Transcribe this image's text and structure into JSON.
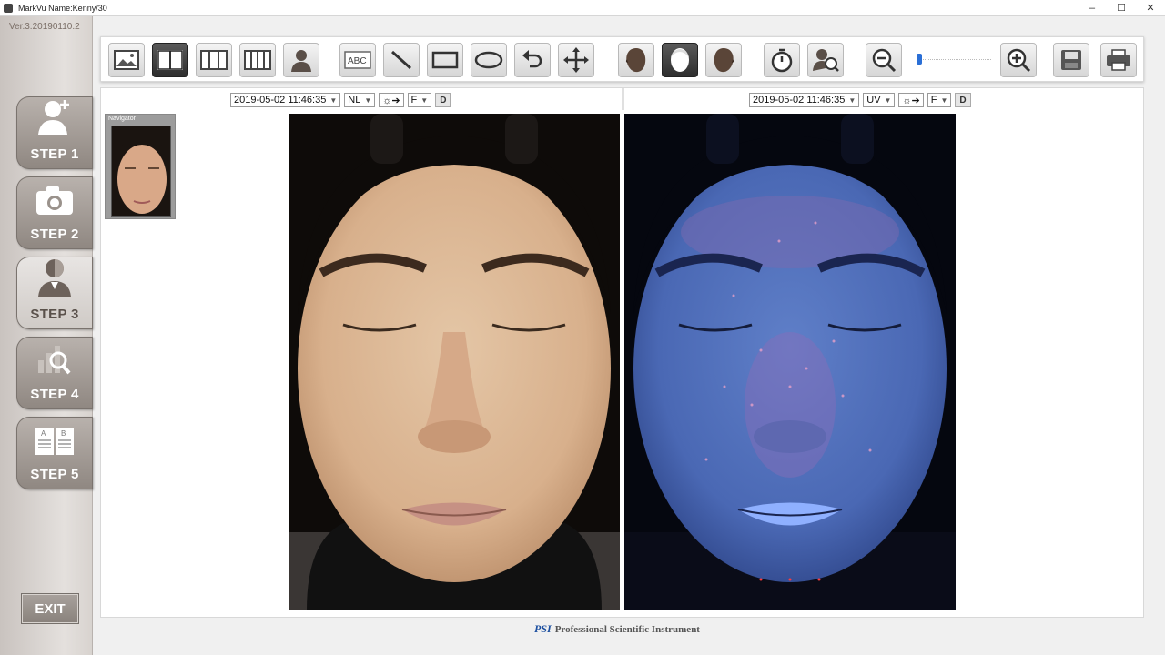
{
  "window": {
    "title": "MarkVu  Name:Kenny/30",
    "minimize": "–",
    "maximize": "☐",
    "close": "✕"
  },
  "sidebar": {
    "version": "Ver.3.20190110.2",
    "steps": [
      {
        "label": "STEP 1",
        "icon": "add-user-icon"
      },
      {
        "label": "STEP 2",
        "icon": "camera-icon"
      },
      {
        "label": "STEP 3",
        "icon": "person-half-icon"
      },
      {
        "label": "STEP 4",
        "icon": "chart-search-icon"
      },
      {
        "label": "STEP 5",
        "icon": "compare-book-icon"
      }
    ],
    "active_step": 3,
    "exit_label": "EXIT"
  },
  "toolbar": {
    "tools": [
      "image-icon",
      "split-view-icon",
      "triple-view-icon",
      "quad-view-icon",
      "person-icon",
      "text-abc-icon",
      "line-icon",
      "rectangle-icon",
      "ellipse-icon",
      "undo-icon",
      "move-icon",
      "face-left-icon",
      "face-front-icon",
      "face-right-icon",
      "timer-icon",
      "zoom-person-icon",
      "zoom-out-icon",
      "zoom-in-icon",
      "save-icon",
      "print-icon"
    ],
    "zoom_level": 0
  },
  "left_view": {
    "date": "2019-05-02 11:46:35",
    "mode": "NL",
    "position": "F",
    "d_button": "D"
  },
  "right_view": {
    "date": "2019-05-02 11:46:35",
    "mode": "UV",
    "position": "F",
    "d_button": "D"
  },
  "navigator": {
    "title": "Navigator"
  },
  "footer": {
    "logo": "PSI",
    "text": "Professional Scientific Instrument"
  }
}
